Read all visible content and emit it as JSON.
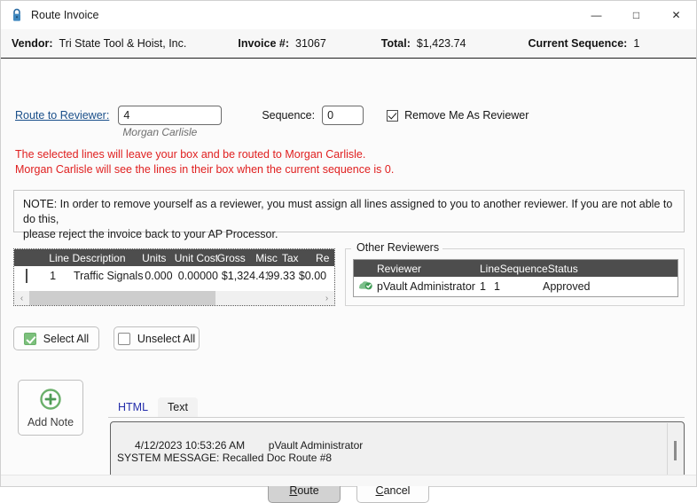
{
  "window": {
    "title": "Route Invoice",
    "icon": "padlock-icon",
    "minimize": "—",
    "maximize": "□",
    "close": "✕"
  },
  "infobar": {
    "vendor_label": "Vendor:",
    "vendor_value": "Tri State Tool & Hoist, Inc.",
    "invoice_label": "Invoice #:",
    "invoice_value": "31067",
    "total_label": "Total:",
    "total_value": "$1,423.74",
    "sequence_label": "Current Sequence:",
    "sequence_value": "1"
  },
  "route": {
    "link_label": "Route to Reviewer:",
    "reviewer_value": "4",
    "reviewer_name": "Morgan Carlisle",
    "sequence_label": "Sequence:",
    "sequence_value": "0",
    "remove_me_label": "Remove Me As Reviewer",
    "remove_me_checked": true
  },
  "warnings": {
    "line1": "The selected lines will leave your box and be routed to Morgan Carlisle.",
    "line2": "Morgan Carlisle will see the lines in their box when the current sequence is 0.",
    "color": "#e02020"
  },
  "note_box": {
    "line1": "NOTE: In order to remove yourself as a reviewer, you must assign all lines assigned to you to another reviewer. If you are not able to do this,",
    "line2": "please reject the invoice back to your AP Processor."
  },
  "lines_grid": {
    "columns": [
      "Line",
      "Description",
      "Units",
      "Unit Cost",
      "Gross",
      "Misc",
      "Tax",
      "Re"
    ],
    "rows": [
      {
        "selected": false,
        "line": "1",
        "description": "Traffic Signals",
        "units": "0.000",
        "unit_cost": "0.00000",
        "gross": "$1,324.41",
        "misc": "99.33",
        "tax": "$0.00"
      }
    ],
    "scroll_left_arrow": "‹",
    "scroll_right_arrow": "›"
  },
  "other_reviewers": {
    "group_title": "Other Reviewers",
    "columns": [
      "Reviewer",
      "Line",
      "Sequence",
      "Status"
    ],
    "rows": [
      {
        "icon": "approved-reviewer-icon",
        "reviewer": "pVault Administrator",
        "line": "1",
        "sequence": "1",
        "status": "Approved"
      }
    ]
  },
  "selection": {
    "select_all_label": "Select All",
    "unselect_all_label": "Unselect All",
    "select_all_checked": true,
    "unselect_all_checked": false
  },
  "add_note": {
    "label": "Add Note",
    "icon": "plus-circle-icon",
    "icon_color": "#6bb06b"
  },
  "notes": {
    "tabs": [
      {
        "label": "HTML",
        "active": false
      },
      {
        "label": "Text",
        "active": true
      }
    ],
    "content": "4/12/2023 10:53:26 AM        pVault Administrator\nSYSTEM MESSAGE: Recalled Doc Route #8"
  },
  "footer": {
    "route_label_pre": "",
    "route_mnemonic": "R",
    "route_label_post": "oute",
    "cancel_mnemonic": "C",
    "cancel_label_post": "ancel"
  }
}
